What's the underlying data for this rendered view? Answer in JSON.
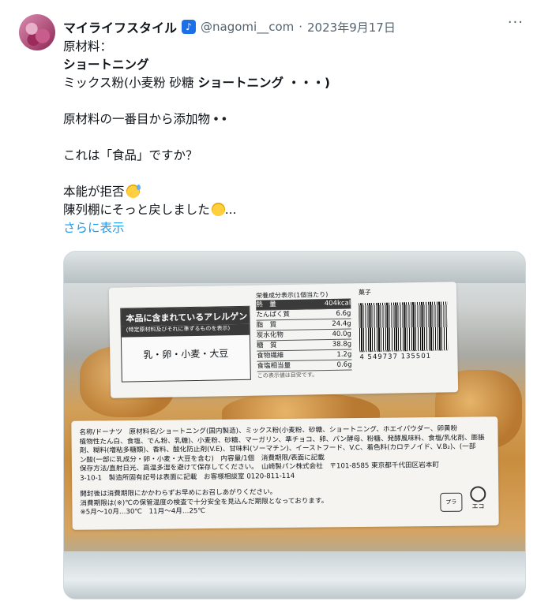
{
  "post": {
    "display_name": "マイライフスタイル",
    "handle": "@nagomi__com",
    "separator": "·",
    "timestamp": "2023年9月17日",
    "more_label": "···",
    "lines": [
      "原材料：",
      "ショートニング",
      "ミックス粉(小麦粉 砂糖 ",
      "ショートニング ・・・)",
      "原材料の一番目から添加物",
      "これは「食品」ですか？",
      "本能が拒否",
      "陳列棚にそっと戻しました",
      "..."
    ],
    "show_more": "さらに表示"
  },
  "photo": {
    "allergen_title": "本品に含まれているアレルゲン",
    "allergen_subtitle": "(特定原材料及びそれに準ずるものを表示)",
    "allergen_items": "乳・卵・小麦・大豆",
    "nutrition_title": "栄養成分表示(1個当たり)",
    "nutrition_rows": [
      {
        "name": "熱　量",
        "value": "404kcal"
      },
      {
        "name": "たんぱく質",
        "value": "6.6g"
      },
      {
        "name": "脂　質",
        "value": "24.4g"
      },
      {
        "name": "炭水化物",
        "value": "40.0g"
      },
      {
        "name": "糖　質",
        "value": "38.8g"
      },
      {
        "name": "食物繊維",
        "value": "1.2g"
      },
      {
        "name": "食塩相当量",
        "value": "0.6g"
      }
    ],
    "nutrition_note": "この表示値は目安です。",
    "barcode_title": "菓子",
    "barcode_number": "4 549737 135501",
    "ingredient_lines": [
      "名称/ドーナツ　原材料名/ショートニング(国内製造)、ミックス粉(小麦粉、砂糖、ショートニング、ホエイパウダー、卵黄粉",
      "植物性たん白、食塩、でん粉、乳糖)、小麦粉、砂糖、マーガリン、準チョコ、卵、パン酵母、粉糖、発酵風味料、食塩/乳化剤、膨脹",
      "剤、糊料(増粘多糖類)、香料、酸化防止剤(V.E)、甘味料(ソーマチン)、イーストフード、V.C、着色料(カロテノイド、V.B₂)、(一部",
      "ン酸(一部に乳成分・卵・小麦・大豆を含む)　内容量/1個　消費期限/表面に記載",
      "保存方法/直射日光、高温多湿を避けて保存してください。　山崎製パン株式会社　〒101-8585 東京都千代田区岩本町",
      "3-10-1　製造所固有記号は表面に記載　お客様相談室 0120-811-114"
    ],
    "notice_lines": [
      "開封後は消費期限にかかわらずお早めにお召しあがりください。",
      "消費期限は(※)℃の保管温度の検査で十分安全を見込んだ期限となっております。",
      "※5月〜10月…30℃　11月〜4月…25℃"
    ],
    "recycle_label": "プラ",
    "recycle_sub": "PP",
    "eco_label": "エコ"
  }
}
